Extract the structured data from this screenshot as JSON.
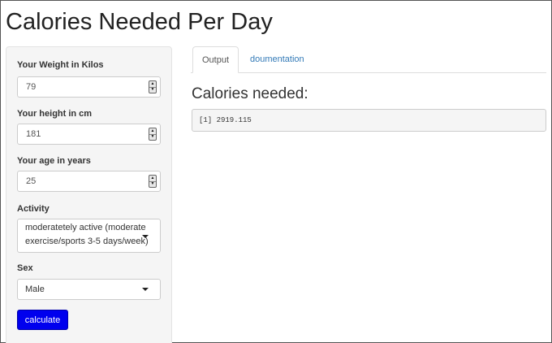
{
  "app": {
    "title": "Calories Needed Per Day"
  },
  "sidebar": {
    "weight": {
      "label": "Your Weight in Kilos",
      "value": "79"
    },
    "height": {
      "label": "Your height in cm",
      "value": "181"
    },
    "age": {
      "label": "Your age in years",
      "value": "25"
    },
    "activity": {
      "label": "Activity",
      "selected_line1": "moderatetely active (moderate",
      "selected_line2": "exercise/sports 3-5 days/week)"
    },
    "sex": {
      "label": "Sex",
      "selected": "Male"
    },
    "calculate_label": "calculate"
  },
  "tabs": [
    {
      "label": "Output",
      "active": true
    },
    {
      "label": "doumentation",
      "active": false
    }
  ],
  "main": {
    "heading": "Calories needed:",
    "result": "[1] 2919.115"
  },
  "colors": {
    "button_bg": "#0000ee",
    "link": "#337ab7",
    "panel_bg": "#f5f5f5"
  },
  "icons": {
    "spinner": "up-down-spinner-icon",
    "dropdown": "caret-down-icon"
  }
}
